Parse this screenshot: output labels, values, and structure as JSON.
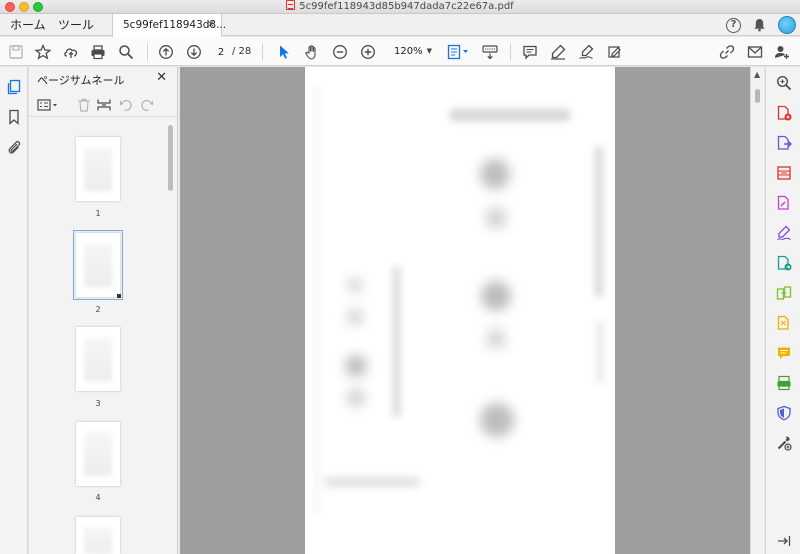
{
  "window": {
    "title": "5c99fef118943d85b947dada7c22e67a.pdf"
  },
  "tabs": {
    "home_label": "ホーム",
    "tools_label": "ツール",
    "document_tab_label": "5c99fef118943d8...",
    "document_tab_close": "×"
  },
  "toolbar": {
    "current_page": "2",
    "total_pages": "/ 28",
    "zoom_level": "120%"
  },
  "thumbnail_panel": {
    "title": "ページサムネール",
    "close_label": "✕",
    "pages": [
      {
        "number": "1",
        "selected": false
      },
      {
        "number": "2",
        "selected": true
      },
      {
        "number": "3",
        "selected": false
      },
      {
        "number": "4",
        "selected": false
      }
    ]
  },
  "colors": {
    "accent_blue": "#1473e6",
    "toolbar_icon": "#4b4b4b",
    "close_red": "#fc5f57",
    "minimize_yellow": "#fdbc2e",
    "maximize_green": "#28c840",
    "doc_background": "#9e9e9e"
  },
  "right_tools": [
    {
      "icon": "zoom-search-icon",
      "color": "#4b4b4b"
    },
    {
      "icon": "create-pdf-icon",
      "color": "#e0302f"
    },
    {
      "icon": "export-pdf-icon",
      "color": "#7a4fd1"
    },
    {
      "icon": "organize-pages-icon",
      "color": "#e0302f"
    },
    {
      "icon": "edit-pdf-icon",
      "color": "#c93ed1"
    },
    {
      "icon": "fill-sign-icon",
      "color": "#7a4fd1"
    },
    {
      "icon": "send-for-signature-icon",
      "color": "#1b9e8e"
    },
    {
      "icon": "combine-files-icon",
      "color": "#7cc32b"
    },
    {
      "icon": "compress-pdf-icon",
      "color": "#e3b400"
    },
    {
      "icon": "comment-icon",
      "color": "#f0b400"
    },
    {
      "icon": "scan-ocr-icon",
      "color": "#3aa23a"
    },
    {
      "icon": "protect-icon",
      "color": "#4b5fd1"
    },
    {
      "icon": "more-tools-icon",
      "color": "#4b4b4b"
    }
  ]
}
